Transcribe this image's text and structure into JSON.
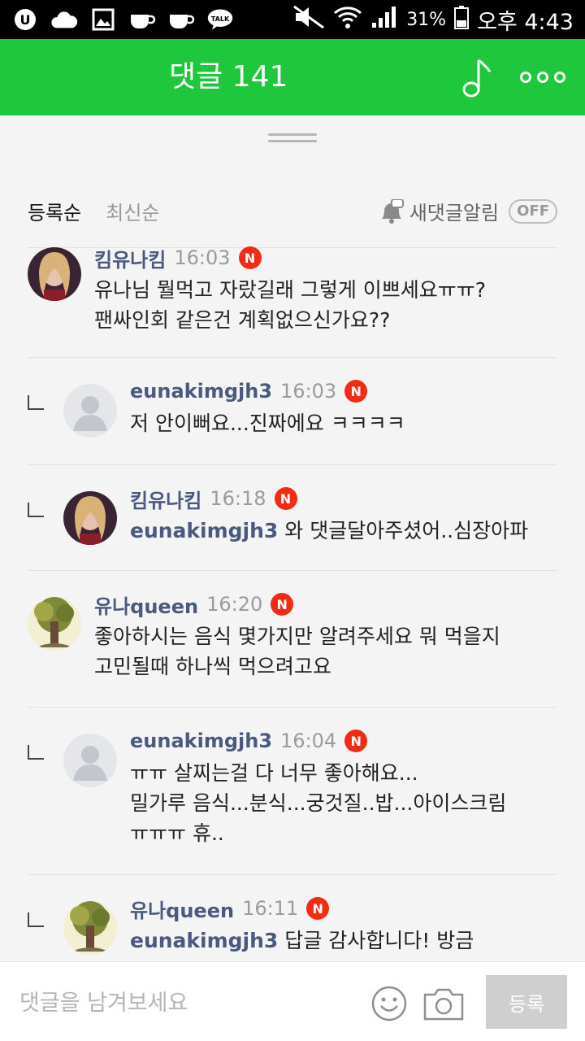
{
  "statusbar": {
    "battery": "31%",
    "time": "오후 4:43",
    "icons": [
      "u-plus-icon",
      "cloud-icon",
      "gallery-icon",
      "cup-icon",
      "cup-icon",
      "kakaotalk-icon",
      "mute-icon",
      "wifi-icon",
      "signal-icon",
      "battery-icon"
    ]
  },
  "header": {
    "title": "댓글 141",
    "accent": "#1ec73c"
  },
  "sort": {
    "active": "등록순",
    "inactive": "최신순"
  },
  "notify": {
    "label": "새댓글알림",
    "toggle": "OFF"
  },
  "comments": [
    {
      "name": "킴유나킴",
      "time": "16:03",
      "badge": "N",
      "lines": [
        "유나님 뭘먹고 자랐길래 그렇게 이쁘세요ㅠㅠ?",
        "팬싸인회 같은건 계획없으신가요??"
      ]
    },
    {
      "name": "eunakimgjh3",
      "time": "16:03",
      "badge": "N",
      "lines": [
        "저 안이뻐요...진짜에요 ㅋㅋㅋㅋ"
      ]
    },
    {
      "name": "킴유나킴",
      "time": "16:18",
      "badge": "N",
      "mention": "eunakimgjh3",
      "text": "와 댓글달아주셨어..심장아파"
    },
    {
      "name": "유나queen",
      "time": "16:20",
      "badge": "N",
      "lines": [
        "좋아하시는 음식 몇가지만 알려주세요 뭐 먹을지",
        "고민될때 하나씩 먹으려고요"
      ]
    },
    {
      "name": "eunakimgjh3",
      "time": "16:04",
      "badge": "N",
      "lines": [
        "ㅠㅠ 살찌는걸 다 너무 좋아해요...",
        "밀가루 음식...분식...궁것질..밥...아이스크림",
        "ㅠㅠㅠ 휴.."
      ]
    },
    {
      "name": "유나queen",
      "time": "16:11",
      "badge": "N",
      "mention": "eunakimgjh3",
      "text": "답글 감사합니다! 방금"
    }
  ],
  "input": {
    "placeholder": "댓글을 남겨보세요",
    "submit": "등록"
  }
}
